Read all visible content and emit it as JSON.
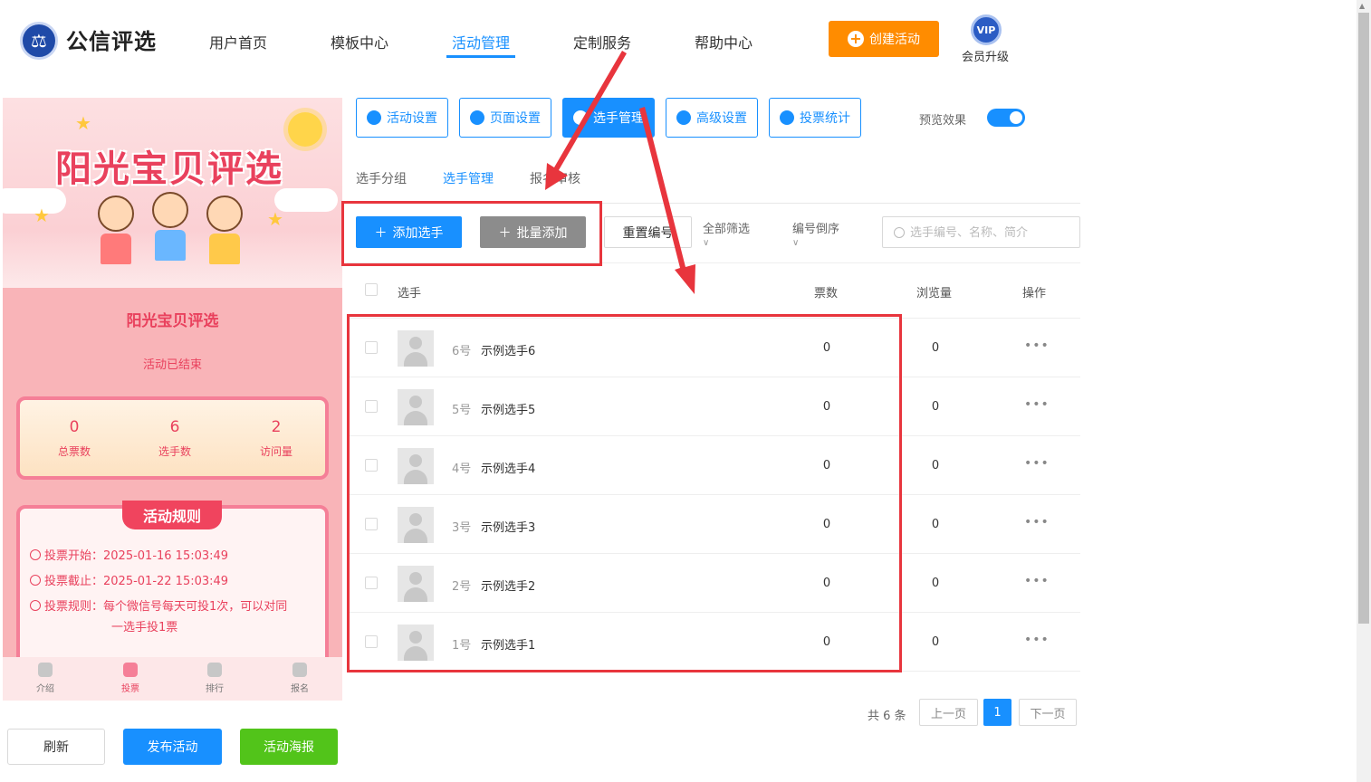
{
  "header": {
    "logo_text": "公信评选",
    "nav": [
      "用户首页",
      "模板中心",
      "活动管理",
      "定制服务",
      "帮助中心"
    ],
    "create_label": "创建活动",
    "vip_badge": "VIP",
    "vip_label": "会员升级"
  },
  "preview": {
    "banner_title": "阳光宝贝评选",
    "title": "阳光宝贝评选",
    "status": "活动已结束",
    "stats": [
      {
        "value": "0",
        "label": "总票数"
      },
      {
        "value": "6",
        "label": "选手数"
      },
      {
        "value": "2",
        "label": "访问量"
      }
    ],
    "rules_title": "活动规则",
    "rules": [
      "投票开始：2025-01-16 15:03:49",
      "投票截止：2025-01-22 15:03:49",
      "投票规则：每个微信号每天可投1次，可以对同",
      "一选手投1票"
    ],
    "tabs": [
      "介绍",
      "投票",
      "排行",
      "报名"
    ]
  },
  "bottom_buttons": {
    "refresh": "刷新",
    "publish": "发布活动",
    "poster": "活动海报"
  },
  "toolbar": {
    "buttons": [
      "活动设置",
      "页面设置",
      "选手管理",
      "高级设置",
      "投票统计"
    ],
    "preview_label": "预览效果"
  },
  "subtabs": [
    "选手分组",
    "选手管理",
    "报名审核"
  ],
  "actions": {
    "add": "添加选手",
    "batch": "批量添加",
    "reset": "重置编号",
    "filter": "全部筛选",
    "sort": "编号倒序",
    "search_placeholder": "选手编号、名称、简介"
  },
  "table": {
    "headers": {
      "player": "选手",
      "votes": "票数",
      "views": "浏览量",
      "ops": "操作"
    },
    "rows": [
      {
        "num": "6号",
        "name": "示例选手6",
        "votes": "0",
        "views": "0",
        "more": "•••"
      },
      {
        "num": "5号",
        "name": "示例选手5",
        "votes": "0",
        "views": "0",
        "more": "•••"
      },
      {
        "num": "4号",
        "name": "示例选手4",
        "votes": "0",
        "views": "0",
        "more": "•••"
      },
      {
        "num": "3号",
        "name": "示例选手3",
        "votes": "0",
        "views": "0",
        "more": "•••"
      },
      {
        "num": "2号",
        "name": "示例选手2",
        "votes": "0",
        "views": "0",
        "more": "•••"
      },
      {
        "num": "1号",
        "name": "示例选手1",
        "votes": "0",
        "views": "0",
        "more": "•••"
      }
    ]
  },
  "pager": {
    "total": "共 6 条",
    "prev": "上一页",
    "page": "1",
    "next": "下一页"
  },
  "colors": {
    "accent": "#1890ff",
    "create": "#ff8c00",
    "annotation": "#e8353d",
    "poster": "#52c41a"
  }
}
